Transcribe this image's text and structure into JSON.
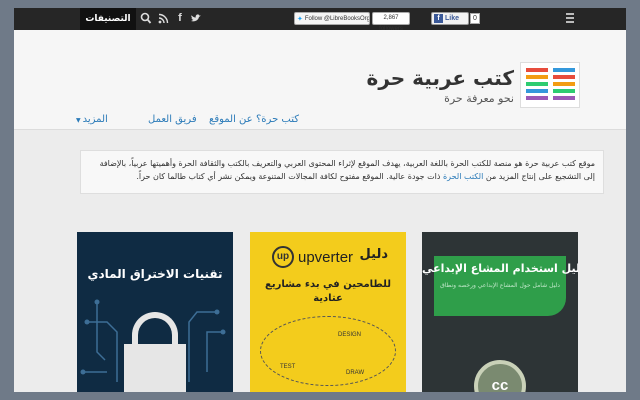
{
  "topbar": {
    "categories_label": "التصنيفات",
    "search_icon": "search-icon",
    "social_icons": [
      "rss-icon",
      "facebook-icon",
      "twitter-icon"
    ],
    "twitter_follow_label": "Follow @LibreBooksOrg",
    "twitter_count": "2,867 followers",
    "facebook_like_label": "Like",
    "facebook_count": "0",
    "menu_icon": "menu-icon"
  },
  "header": {
    "site_title": "كتب عربية حرة",
    "tagline": "نحو معرفة حرة",
    "logo_colors": [
      "#e74c3c",
      "#f39c12",
      "#2ecc71",
      "#3498db",
      "#9b59b6"
    ]
  },
  "nav": {
    "items": [
      {
        "label": "كتب حرة؟"
      },
      {
        "label": "عن الموقع"
      },
      {
        "label": "فريق العمل"
      },
      {
        "label": "المزيد"
      }
    ]
  },
  "intro": {
    "text_before": "موقع كتب عربية حرة هو منصة للكتب الحرة باللغة العربية، يهدف الموقع لإثراء المحتوى العربي والتعريف بالكتب والثقافة الحرة وأهميتها عربياً، بالإضافة إلى التشجيع على إنتاج المزيد من ",
    "link_text": "الكتب الحرة",
    "text_after": " ذات جودة عالية. الموقع مفتوح لكافة المجالات المتنوعة ويمكن نشر أي كتاب طالما كان حراً."
  },
  "cards": [
    {
      "title": "دليل استخدام المشاع الإبداعي",
      "subtitle": "دليل شامل حول المشاع الإبداعي ورخصه ونطاق",
      "badge": "cc"
    },
    {
      "title": "للطامحين في بدء مشاريع عتادية",
      "guide_label": "دليل",
      "brand": "upverter",
      "sketch_labels": [
        "DESIGN",
        "TEST",
        "DRAW"
      ]
    },
    {
      "title": "تقنيات الاختراق المادي",
      "icon": "lock-icon"
    }
  ],
  "colors": {
    "topbar_bg": "#262626",
    "link": "#2a7ab8",
    "card1_bg": "#2d3436",
    "card1_accent": "#2f9e4a",
    "card2_bg": "#f3cc1c",
    "card3_bg": "#0f2b43"
  }
}
